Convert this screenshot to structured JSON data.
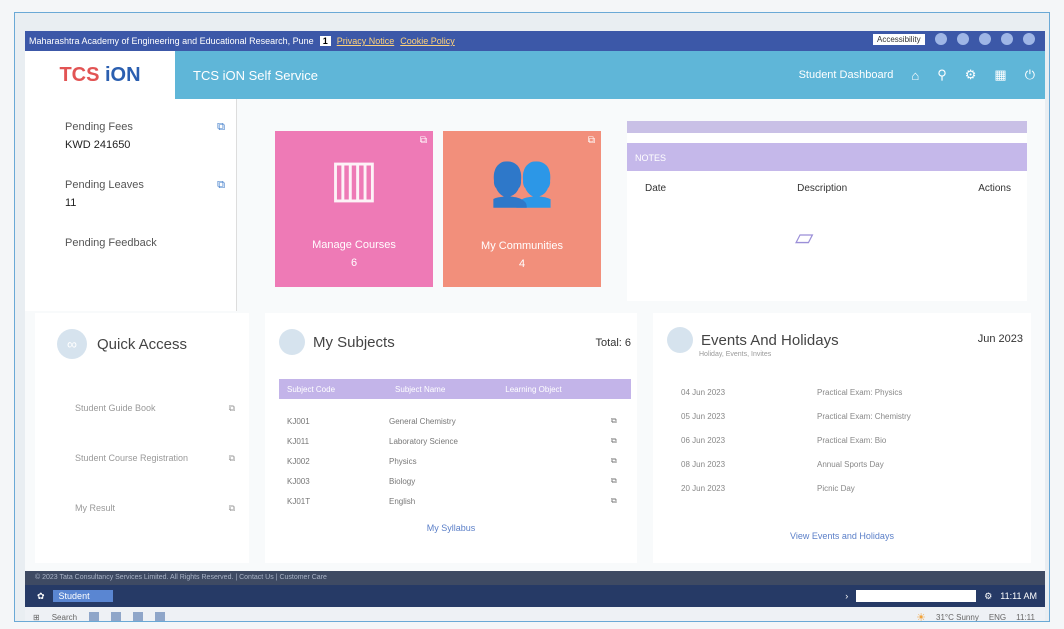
{
  "browser_bar": {
    "title": "Maharashtra Academy of Engineering and Educational Research, Pune",
    "page_badge": "1",
    "privacy": "Privacy Notice",
    "cookie": "Cookie Policy",
    "lang": "Accessibility"
  },
  "header": {
    "logo_prefix": "TCS",
    "logo_suffix": "iON",
    "app_title": "TCS iON Self Service",
    "dashboard_label": "Student Dashboard"
  },
  "left_panel": {
    "items": [
      {
        "label": "Pending Fees",
        "value": "KWD 241650"
      },
      {
        "label": "Pending Leaves",
        "value": "11"
      },
      {
        "label": "Pending Feedback",
        "value": ""
      }
    ]
  },
  "tiles": [
    {
      "label": "Manage Courses",
      "count": "6",
      "color": "#ee7ab6"
    },
    {
      "label": "My Communities",
      "count": "4",
      "color": "#f28f7b"
    }
  ],
  "notes": {
    "heading": "NOTES",
    "col_date": "Date",
    "col_desc": "Description",
    "col_actions": "Actions"
  },
  "quick_access": {
    "title": "Quick Access",
    "items": [
      "Student Guide Book",
      "Student Course Registration",
      "My Result"
    ]
  },
  "subjects": {
    "title": "My Subjects",
    "total": "Total: 6",
    "headers": [
      "Subject Code",
      "Subject Name",
      "Learning Object"
    ],
    "rows": [
      {
        "code": "KJ001",
        "name": "General Chemistry"
      },
      {
        "code": "KJ011",
        "name": "Laboratory Science"
      },
      {
        "code": "KJ002",
        "name": "Physics"
      },
      {
        "code": "KJ003",
        "name": "Biology"
      },
      {
        "code": "KJ01T",
        "name": "English"
      }
    ],
    "footer": "My Syllabus"
  },
  "events": {
    "title": "Events And Holidays",
    "subtitle": "Holiday, Events, Invites",
    "month": "Jun 2023",
    "rows": [
      {
        "date": "04 Jun 2023",
        "desc": "Practical Exam: Physics"
      },
      {
        "date": "05 Jun 2023",
        "desc": "Practical Exam: Chemistry"
      },
      {
        "date": "06 Jun 2023",
        "desc": "Practical Exam: Bio"
      },
      {
        "date": "08 Jun 2023",
        "desc": "Annual Sports Day"
      },
      {
        "date": "20 Jun 2023",
        "desc": "Picnic Day"
      }
    ],
    "footer": "View Events and Holidays"
  },
  "status_line": "© 2023 Tata Consultancy Services Limited. All Rights Reserved. | Contact Us | Customer Care",
  "os_bar": {
    "field": "Student",
    "time": "11:11 AM"
  },
  "taskbar": {
    "search": "Search",
    "weather": "31°C Sunny",
    "lang": "ENG",
    "clock": "11:11"
  }
}
